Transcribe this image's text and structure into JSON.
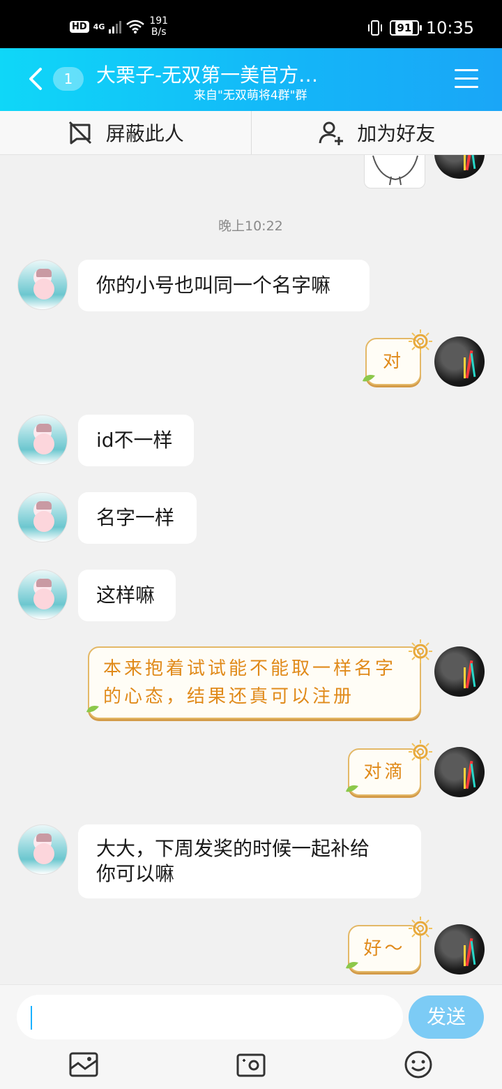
{
  "status_bar": {
    "hd": "HD",
    "network": "4G",
    "speed_value": "191",
    "speed_unit": "B/s",
    "battery": "91",
    "time": "10:35"
  },
  "header": {
    "unread_count": "1",
    "title": "大栗子-无双第一美官方…",
    "subtitle": "来自\"无双萌将4群\"群",
    "back_icon": "chevron-left-icon",
    "menu_icon": "hamburger-menu-icon"
  },
  "actions": {
    "block_label": "屏蔽此人",
    "add_friend_label": "加为好友"
  },
  "chat": {
    "timestamp": "晚上10:22",
    "messages": [
      {
        "from": "other",
        "text": "你的小号也叫同一个名字嘛"
      },
      {
        "from": "self",
        "text": "对"
      },
      {
        "from": "other",
        "text": "id不一样"
      },
      {
        "from": "other",
        "text": "名字一样"
      },
      {
        "from": "other",
        "text": "这样嘛"
      },
      {
        "from": "self",
        "line1": "本来抱着试试能不能取一样名字",
        "line2": "的心态，结果还真可以注册"
      },
      {
        "from": "self",
        "text": "对滴"
      },
      {
        "from": "other",
        "line1": "大大，下周发奖的时候一起补给",
        "line2": "你可以嘛"
      },
      {
        "from": "self",
        "text": "好～"
      }
    ]
  },
  "composer": {
    "send_label": "发送",
    "tools": [
      "image-icon",
      "camera-icon",
      "emoji-icon"
    ]
  },
  "colors": {
    "header_gradient_start": "#0fd7f8",
    "header_gradient_end": "#1aa6f7",
    "self_bubble_text": "#e08a1a",
    "send_button": "#7ccbf5"
  }
}
